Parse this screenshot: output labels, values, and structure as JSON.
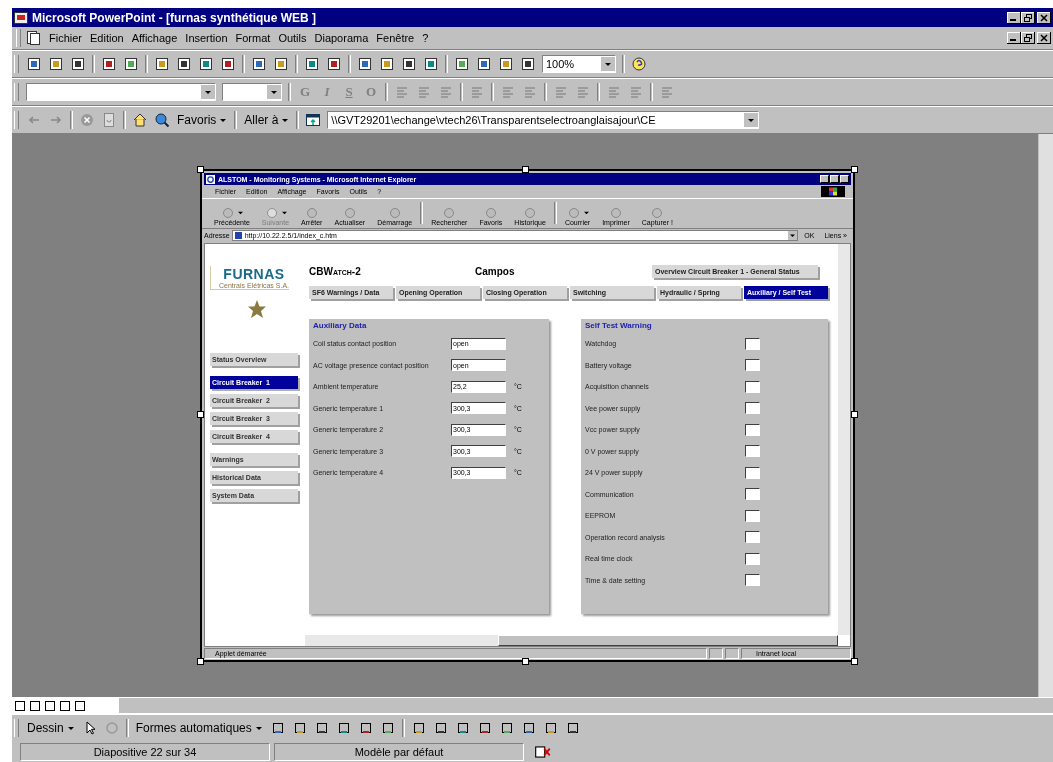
{
  "ppt": {
    "title": "Microsoft PowerPoint - [furnas synthétique  WEB ]",
    "menu": [
      "Fichier",
      "Edition",
      "Affichage",
      "Insertion",
      "Format",
      "Outils",
      "Diaporama",
      "Fenêtre",
      "?"
    ],
    "zoom": "100%",
    "format_buttons": [
      "G",
      "I",
      "S",
      "O"
    ],
    "web_toolbar": {
      "favorites": "Favoris",
      "goto": "Aller à",
      "address": "\\\\GVT29201\\echange\\vtech26\\Transparentselectroanglaisajour\\CE"
    },
    "drawing_toolbar": {
      "draw": "Dessin",
      "autoshapes": "Formes automatiques"
    },
    "status_bar": [
      "Diapositive 22 sur 34",
      "Modèle par défaut"
    ]
  },
  "ie": {
    "title": "ALSTOM - Monitoring Systems - Microsoft Internet Explorer",
    "menu": [
      "Fichier",
      "Edition",
      "Affichage",
      "Favoris",
      "Outils",
      "?"
    ],
    "toolbar": [
      {
        "label": "Précédente",
        "disabled": false,
        "dropdown": true
      },
      {
        "label": "Suivante",
        "disabled": true,
        "dropdown": true
      },
      {
        "label": "Arrêter",
        "disabled": false,
        "dropdown": false
      },
      {
        "label": "Actualiser",
        "disabled": false,
        "dropdown": false
      },
      {
        "label": "Démarrage",
        "disabled": false,
        "dropdown": false
      },
      {
        "label": "Rechercher",
        "disabled": false,
        "dropdown": false
      },
      {
        "label": "Favoris",
        "disabled": false,
        "dropdown": false
      },
      {
        "label": "Historique",
        "disabled": false,
        "dropdown": false
      },
      {
        "label": "Courrier",
        "disabled": false,
        "dropdown": true
      },
      {
        "label": "Imprimer",
        "disabled": false,
        "dropdown": false
      },
      {
        "label": "Capturer !",
        "disabled": false,
        "dropdown": false
      }
    ],
    "address_label": "Adresse",
    "url": "http://10.22.2.5/1/index_c.htm",
    "go": "OK",
    "links": "Liens »",
    "status": "Applet démarrée",
    "zone": "Intranet local"
  },
  "page": {
    "logo": {
      "name": "FURNAS",
      "subtitle": "Centrais Elétricas S.A."
    },
    "product": "CBWatch-2",
    "site": "Campos",
    "overview": "Overview Circuit Breaker 1 - General Status",
    "tabs": [
      {
        "label": "SF6 Warnings / Data",
        "selected": false
      },
      {
        "label": "Opening Operation",
        "selected": false
      },
      {
        "label": "Closing Operation",
        "selected": false
      },
      {
        "label": "Switching",
        "selected": false
      },
      {
        "label": "Hydraulic / Spring",
        "selected": false
      },
      {
        "label": "Auxiliary / Self Test",
        "selected": true
      }
    ],
    "nav": [
      [
        {
          "label": "Status Overview",
          "selected": false
        }
      ],
      [
        {
          "label": "Circuit Breaker  1",
          "selected": true
        },
        {
          "label": "Circuit Breaker  2",
          "selected": false
        },
        {
          "label": "Circuit Breaker  3",
          "selected": false
        },
        {
          "label": "Circuit Breaker  4",
          "selected": false
        }
      ],
      [
        {
          "label": "Warnings",
          "selected": false
        },
        {
          "label": "Historical Data",
          "selected": false
        },
        {
          "label": "System Data",
          "selected": false
        }
      ]
    ],
    "aux": {
      "title": "Auxiliary Data",
      "rows": [
        {
          "label": "Coil status contact position",
          "value": "open"
        },
        {
          "label": "AC voltage presence contact position",
          "value": "open"
        },
        {
          "label": "Ambient temperature",
          "value": "25,2",
          "unit": "°C"
        },
        {
          "label": "Generic temperature 1",
          "value": "300,3",
          "unit": "°C"
        },
        {
          "label": "Generic temperature 2",
          "value": "300,3",
          "unit": "°C"
        },
        {
          "label": "Generic temperature 3",
          "value": "300,3",
          "unit": "°C"
        },
        {
          "label": "Generic temperature 4",
          "value": "300,3",
          "unit": "°C"
        }
      ]
    },
    "selftest": {
      "title": "Self Test Warning",
      "items": [
        "Watchdog",
        "Battery voltage",
        "Acquisition channels",
        "Vee power supply",
        "Vcc power supply",
        "0 V power supply",
        "24 V power supply",
        "Communication",
        "EEPROM",
        "Operation record analysis",
        "Real time clock",
        "Time & date setting"
      ]
    }
  }
}
